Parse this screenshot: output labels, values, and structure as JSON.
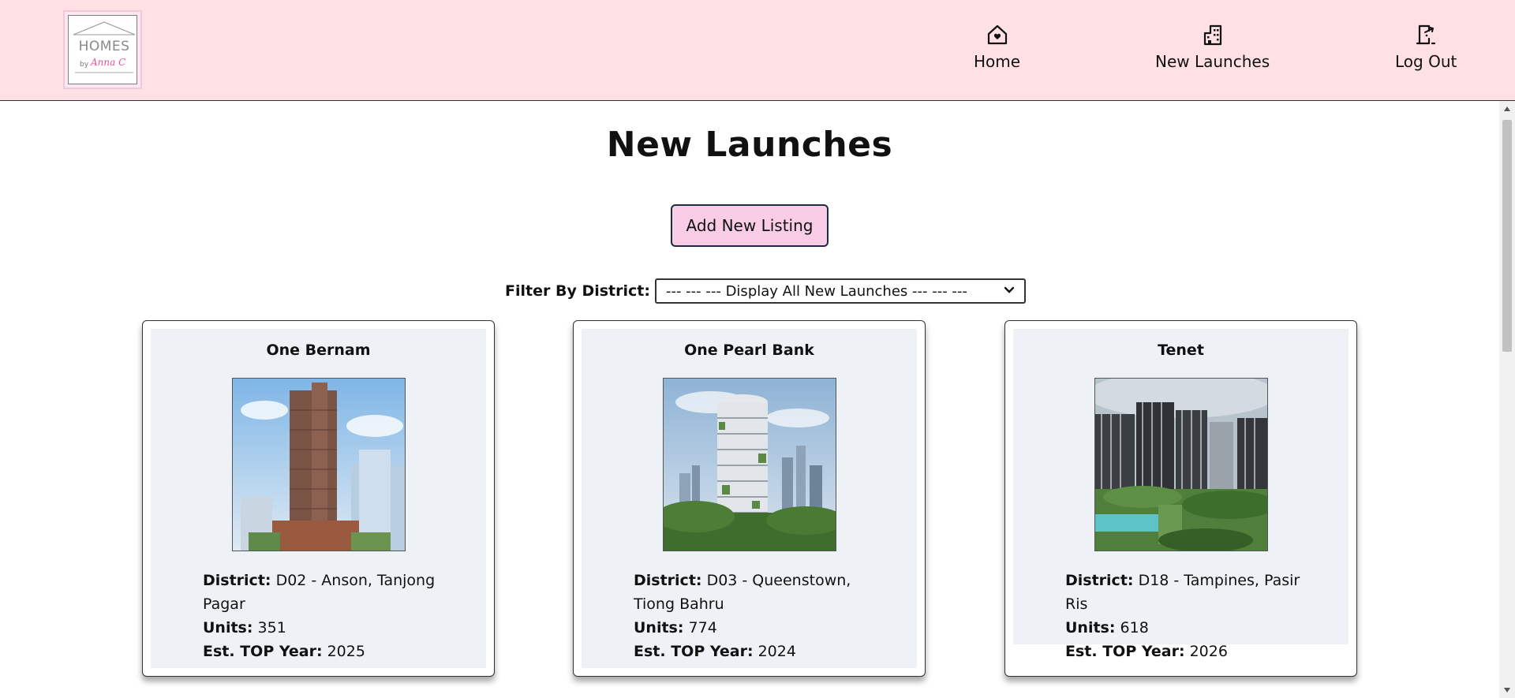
{
  "header": {
    "logo": {
      "line1": "HOMES",
      "line2": "by Anna C"
    },
    "nav": [
      {
        "label": "Home",
        "icon": "home-heart-icon"
      },
      {
        "label": "New Launches",
        "icon": "building-icon"
      },
      {
        "label": "Log Out",
        "icon": "logout-door-icon"
      }
    ]
  },
  "main": {
    "title": "New Launches",
    "add_button": "Add New Listing",
    "filter": {
      "label": "Filter By District:",
      "selected": "--- --- --- Display All New Launches --- --- ---"
    }
  },
  "listings": [
    {
      "name": "One Bernam",
      "district_label": "District:",
      "district": "D02 - Anson, Tanjong Pagar",
      "units_label": "Units:",
      "units": "351",
      "top_label": "Est. TOP Year:",
      "top_year": "2025"
    },
    {
      "name": "One Pearl Bank",
      "district_label": "District:",
      "district": "D03 - Queenstown, Tiong Bahru",
      "units_label": "Units:",
      "units": "774",
      "top_label": "Est. TOP Year:",
      "top_year": "2024"
    },
    {
      "name": "Tenet",
      "district_label": "District:",
      "district": "D18 - Tampines, Pasir Ris",
      "units_label": "Units:",
      "units": "618",
      "top_label": "Est. TOP Year:",
      "top_year": "2026"
    }
  ],
  "colors": {
    "header_bg": "#ffe0e4",
    "button_bg": "#f9cde6",
    "card_inner_bg": "#eef2f7",
    "logo_accent": "#e2559a"
  }
}
